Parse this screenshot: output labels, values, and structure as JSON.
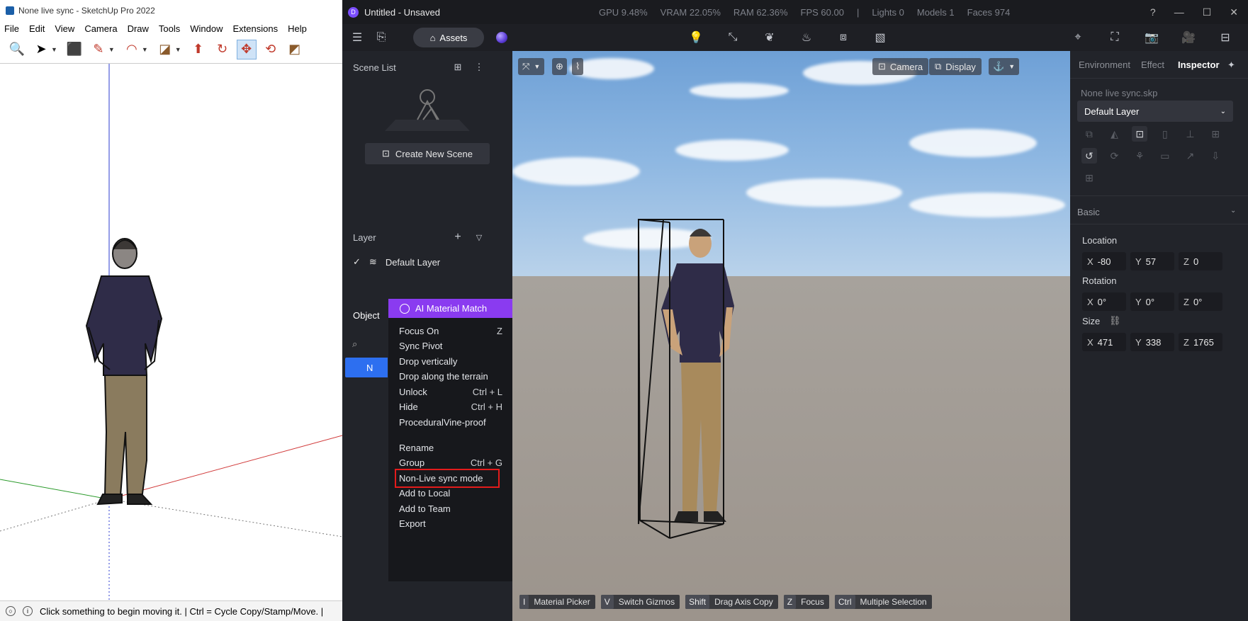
{
  "sketchup": {
    "title": "None live sync - SketchUp Pro 2022",
    "menu": [
      "File",
      "Edit",
      "View",
      "Camera",
      "Draw",
      "Tools",
      "Window",
      "Extensions",
      "Help"
    ],
    "status": "Click something to begin moving it. | Ctrl = Cycle Copy/Stamp/Move. |"
  },
  "d5": {
    "title": "Untitled - Unsaved",
    "stats": [
      "GPU 9.48%",
      "VRAM 22.05%",
      "RAM 62.36%",
      "FPS 60.00",
      "|",
      "Lights 0",
      "Models 1",
      "Faces 974"
    ],
    "assets_label": "Assets",
    "scene_list": {
      "title": "Scene List",
      "create_label": "Create New Scene"
    },
    "layer_panel": {
      "title": "Layer",
      "items": [
        "Default Layer"
      ]
    },
    "object_panel": {
      "title": "Object",
      "selected_prefix": "N"
    },
    "context_menu": {
      "ai_label": "AI Material Match",
      "items": [
        {
          "label": "Focus On",
          "shortcut": "Z"
        },
        {
          "label": "Sync Pivot",
          "shortcut": ""
        },
        {
          "label": "Drop vertically",
          "shortcut": ""
        },
        {
          "label": "Drop along the terrain",
          "shortcut": ""
        },
        {
          "label": "Unlock",
          "shortcut": "Ctrl + L"
        },
        {
          "label": "Hide",
          "shortcut": "Ctrl + H"
        },
        {
          "label": "ProceduralVine-proof",
          "shortcut": ""
        },
        {
          "label": "Rename",
          "shortcut": ""
        },
        {
          "label": "Group",
          "shortcut": "Ctrl + G"
        },
        {
          "label": "Non-Live sync mode",
          "shortcut": ""
        },
        {
          "label": "Add to Local",
          "shortcut": ""
        },
        {
          "label": "Add to Team",
          "shortcut": ""
        },
        {
          "label": "Export",
          "shortcut": ""
        }
      ]
    },
    "viewport": {
      "camera_label": "Camera",
      "display_label": "Display",
      "hints": [
        {
          "key": "I",
          "label": "Material Picker"
        },
        {
          "key": "V",
          "label": "Switch Gizmos"
        },
        {
          "key": "Shift",
          "label": "Drag Axis Copy"
        },
        {
          "key": "Z",
          "label": "Focus"
        },
        {
          "key": "Ctrl",
          "label": "Multiple Selection"
        }
      ]
    },
    "inspector": {
      "tabs": [
        "Environment",
        "Effect",
        "Inspector"
      ],
      "active_tab": "Inspector",
      "file_name": "None live sync.skp",
      "layer": "Default Layer",
      "basic_label": "Basic",
      "location_label": "Location",
      "location": {
        "x": "-80",
        "y": "57",
        "z": "0"
      },
      "rotation_label": "Rotation",
      "rotation": {
        "x": "0°",
        "y": "0°",
        "z": "0°"
      },
      "size_label": "Size",
      "size": {
        "x": "471",
        "y": "338",
        "z": "1765"
      }
    }
  },
  "colors": {
    "accent_purple": "#8a3bf0",
    "selection_blue": "#2d6ff0",
    "highlight_red": "#e31b1b"
  }
}
